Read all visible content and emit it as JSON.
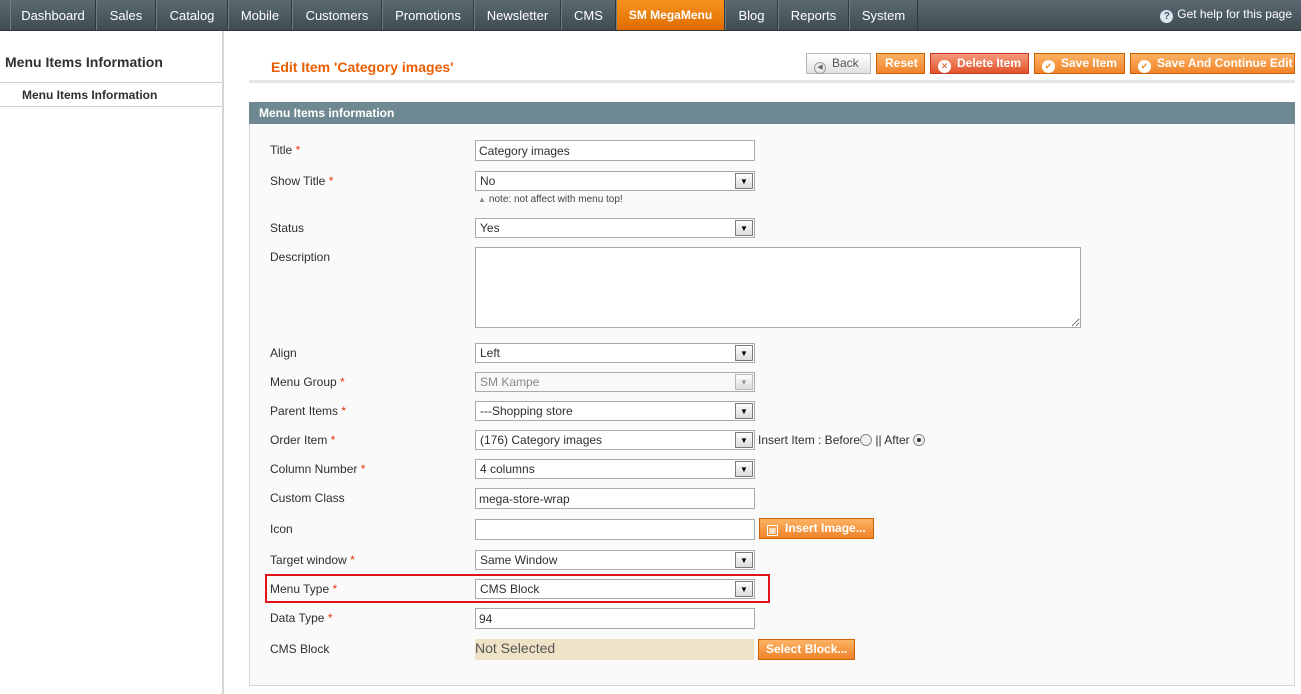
{
  "nav": {
    "items": [
      "Dashboard",
      "Sales",
      "Catalog",
      "Mobile",
      "Customers",
      "Promotions",
      "Newsletter",
      "CMS",
      "SM MegaMenu",
      "Blog",
      "Reports",
      "System"
    ],
    "active": "SM MegaMenu",
    "help": "Get help for this page"
  },
  "sidebar": {
    "title": "Menu Items Information",
    "item": "Menu Items Information"
  },
  "header": {
    "title": "Edit Item 'Category images'",
    "buttons": {
      "back": "Back",
      "reset": "Reset",
      "delete": "Delete Item",
      "save": "Save Item",
      "save_continue": "Save And Continue Edit"
    }
  },
  "form": {
    "section_title": "Menu Items information",
    "title": {
      "label": "Title",
      "value": "Category images"
    },
    "show_title": {
      "label": "Show Title",
      "value": "No",
      "note": "note: not affect with menu top!"
    },
    "status": {
      "label": "Status",
      "value": "Yes"
    },
    "description": {
      "label": "Description",
      "value": ""
    },
    "align": {
      "label": "Align",
      "value": "Left"
    },
    "menu_group": {
      "label": "Menu Group",
      "value": "SM Kampe"
    },
    "parent_items": {
      "label": "Parent Items",
      "value": "---Shopping store"
    },
    "order_item": {
      "label": "Order Item",
      "value": "(176) Category images",
      "insert_label": "Insert Item : Before",
      "sep": "||",
      "after": "After"
    },
    "column_number": {
      "label": "Column Number",
      "value": "4 columns"
    },
    "custom_class": {
      "label": "Custom Class",
      "value": "mega-store-wrap"
    },
    "icon": {
      "label": "Icon",
      "value": "",
      "button": "Insert Image..."
    },
    "target_window": {
      "label": "Target window",
      "value": "Same Window"
    },
    "menu_type": {
      "label": "Menu Type",
      "value": "CMS Block"
    },
    "data_type": {
      "label": "Data Type",
      "value": "94"
    },
    "cms_block": {
      "label": "CMS Block",
      "value": "Not Selected",
      "button": "Select Block..."
    }
  },
  "colors": {
    "accent": "#eb5e00",
    "section_header": "#6f8992",
    "highlight": "#e0131a"
  }
}
